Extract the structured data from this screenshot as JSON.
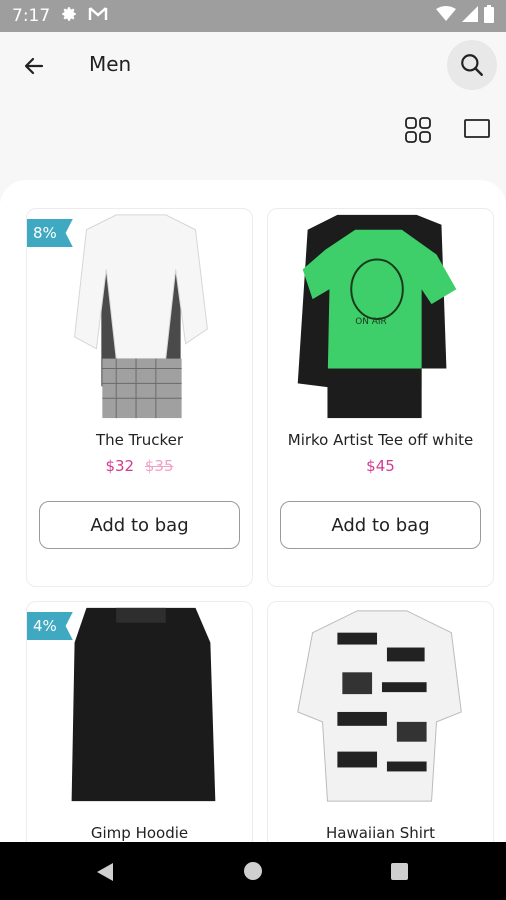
{
  "status_bar": {
    "time": "7:17",
    "icons": [
      "gear-icon",
      "gmail-icon",
      "wifi-icon",
      "signal-icon",
      "battery-icon"
    ]
  },
  "header": {
    "title": "Men",
    "back_icon": "arrow-left-icon",
    "search_icon": "search-icon"
  },
  "view_toggles": {
    "grid_icon": "grid-view-icon",
    "list_icon": "list-view-icon"
  },
  "products": [
    {
      "name": "The Trucker",
      "price": "$32",
      "old_price": "$35",
      "badge": "8%",
      "button": "Add to bag"
    },
    {
      "name": "Mirko Artist Tee off white",
      "price": "$45",
      "old_price": "",
      "badge": "",
      "button": "Add to bag"
    },
    {
      "name": "Gimp Hoodie",
      "price": "",
      "old_price": "",
      "badge": "4%",
      "button": ""
    },
    {
      "name": "Hawaiian Shirt",
      "price": "",
      "old_price": "",
      "badge": "",
      "button": ""
    }
  ],
  "colors": {
    "accent_price": "#d23c8f",
    "old_price": "#f0a2c8",
    "badge": "#40a9c2",
    "status_bar": "#9e9e9e",
    "nav_bar": "#000000"
  }
}
